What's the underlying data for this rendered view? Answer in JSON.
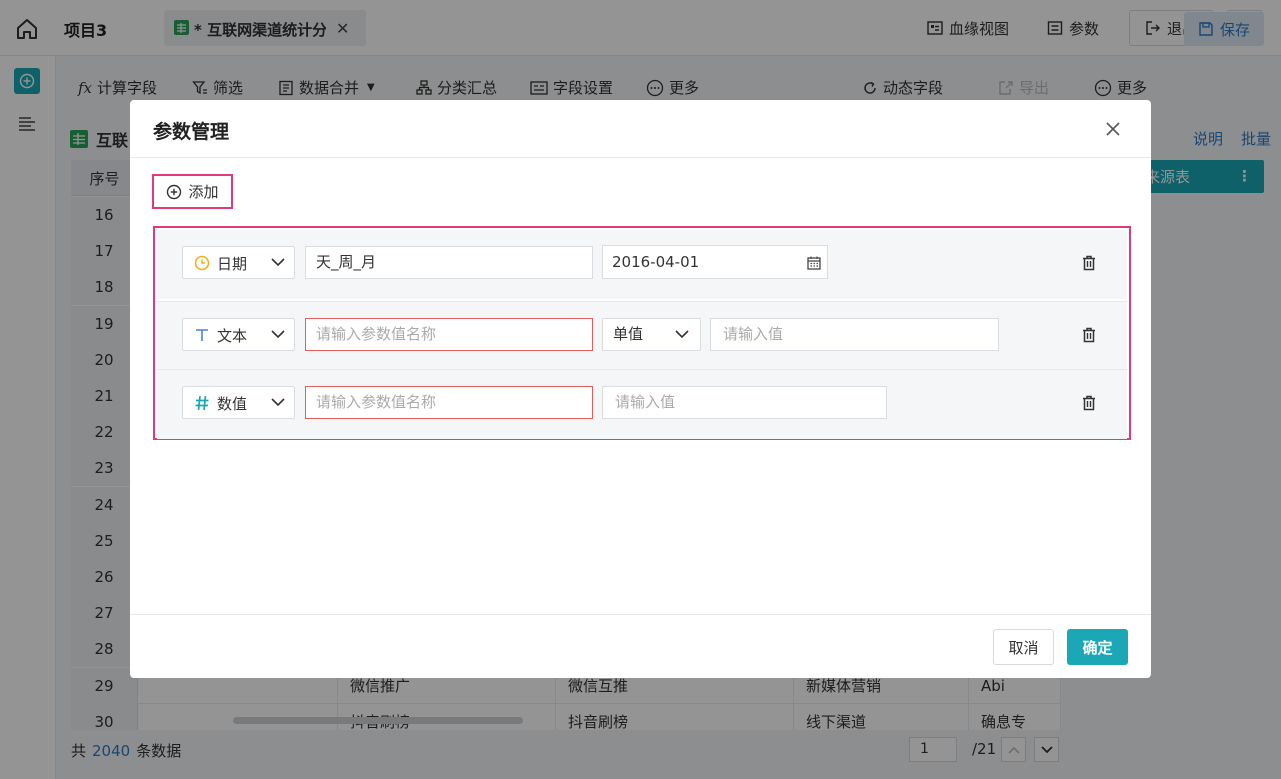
{
  "header": {
    "project_title": "项目3",
    "tab_label": "* 互联网渠道统计分",
    "lineage_view": "血缘视图",
    "params": "参数",
    "logout": "退出"
  },
  "toolbar": {
    "calc_field": "计算字段",
    "filter": "筛选",
    "merge": "数据合并",
    "group_summary": "分类汇总",
    "field_settings": "字段设置",
    "more_left": "更多",
    "dynamic_field": "动态字段",
    "export": "导出",
    "more_right": "更多",
    "save": "保存"
  },
  "dataset": {
    "title": "互联",
    "explain_link": "说明",
    "batch_link": "批量",
    "source_button": "来源表"
  },
  "grid": {
    "seq_header": "序号",
    "row_numbers": [
      "16",
      "17",
      "18",
      "19",
      "20",
      "21",
      "22",
      "23",
      "24",
      "25",
      "26",
      "27",
      "28",
      "29",
      "30"
    ],
    "row29": [
      "微信推广",
      "微信互推",
      "新媒体营销",
      "Abi"
    ],
    "row30": [
      "抖音刷榜",
      "抖音刷榜",
      "线下渠道",
      "确息专"
    ]
  },
  "footer": {
    "total_prefix": "共",
    "total_count": "2040",
    "total_suffix": "条数据",
    "page": "1",
    "page_total": "/21"
  },
  "modal": {
    "title": "参数管理",
    "add_label": "添加",
    "rows": [
      {
        "type": "日期",
        "name": "天_周_月",
        "value": "2016-04-01"
      },
      {
        "type": "文本",
        "name_placeholder": "请输入参数值名称",
        "mode": "单值",
        "value_placeholder": "请输入值"
      },
      {
        "type": "数值",
        "name_placeholder": "请输入参数值名称",
        "value_placeholder": "请输入值"
      }
    ],
    "cancel": "取消",
    "confirm": "确定"
  },
  "colors": {
    "accent": "#1ba7b6",
    "highlight": "#e03a7a",
    "link": "#2b7ac6",
    "error_border": "#e35d5d"
  },
  "icons": [
    "home-icon",
    "sheet-icon",
    "close-icon",
    "lineage-icon",
    "param-icon",
    "logout-icon",
    "more-icon",
    "add-data-icon",
    "list-icon",
    "fx-icon",
    "filter-icon",
    "merge-icon",
    "group-icon",
    "field-settings-icon",
    "refresh-icon",
    "export-icon",
    "save-icon",
    "plus-circle-icon",
    "clock-icon",
    "text-type-icon",
    "hash-icon",
    "chevron-down-icon",
    "calendar-icon",
    "trash-icon"
  ]
}
